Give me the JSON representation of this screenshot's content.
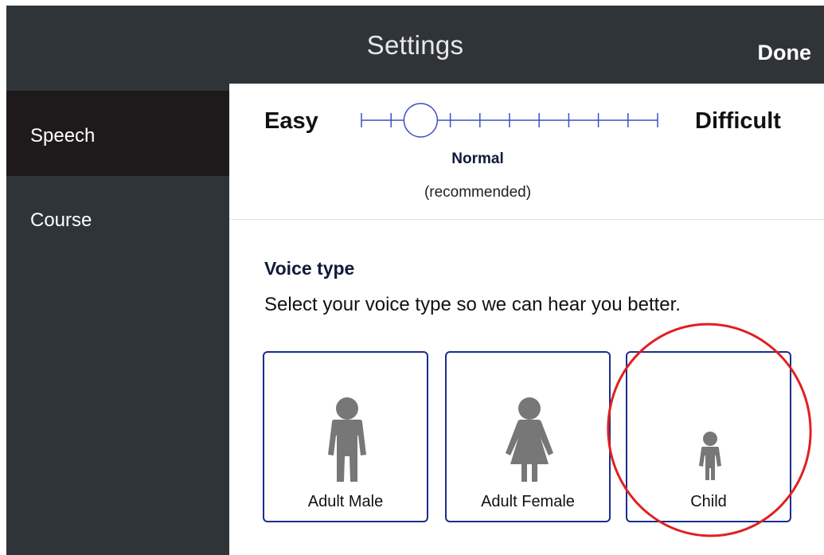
{
  "header": {
    "title": "Settings",
    "done_label": "Done"
  },
  "sidebar": {
    "items": [
      {
        "label": "Speech",
        "active": true
      },
      {
        "label": "Course",
        "active": false
      }
    ]
  },
  "difficulty": {
    "min_label": "Easy",
    "max_label": "Difficult",
    "selected_label": "Normal",
    "selected_note": "(recommended)",
    "selected_step": 2,
    "total_steps": 11
  },
  "voice": {
    "title": "Voice type",
    "description": "Select your voice type so we can hear you better.",
    "options": [
      {
        "label": "Adult Male",
        "icon": "adult-male-icon"
      },
      {
        "label": "Adult Female",
        "icon": "adult-female-icon"
      },
      {
        "label": "Child",
        "icon": "child-icon"
      }
    ]
  },
  "colors": {
    "bar_background": "#2f3439",
    "sidebar_active": "#1e1a1b",
    "card_border": "#1a2e8c",
    "figure_gray": "#777777",
    "annotation_red": "#e02020",
    "slider_line": "#3a52c4"
  }
}
